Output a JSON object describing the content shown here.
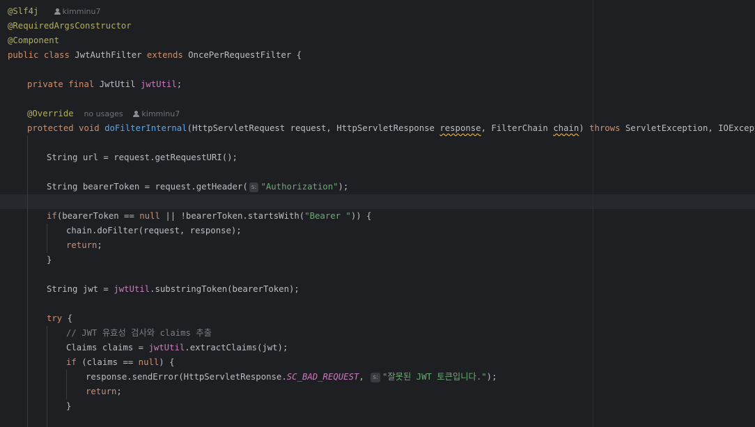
{
  "inlay": {
    "author": "kimminu7",
    "no_usages": "no usages",
    "param_s": "s:"
  },
  "code": {
    "l1_ann": "@Slf4j",
    "l2_ann": "@RequiredArgsConstructor",
    "l3_ann": "@Component",
    "l4_public": "public",
    "l4_class": "class",
    "l4_name": "JwtAuthFilter",
    "l4_extends": "extends",
    "l4_parent": "OncePerRequestFilter {",
    "l6_private": "private",
    "l6_final": "final",
    "l6_type": "JwtUtil",
    "l6_field": "jwtUtil",
    "l6_semi": ";",
    "l8_ann": "@Override",
    "l9_protected": "protected",
    "l9_void": "void",
    "l9_method": "doFilterInternal",
    "l9_params1": "(HttpServletRequest request, HttpServletResponse",
    "l9_response": "response",
    "l9_params2": ", FilterChain",
    "l9_chain": "chain",
    "l9_paren": ")",
    "l9_throws": "throws",
    "l9_exceptions": "ServletException, IOException {",
    "l11": "String url = request.getRequestURI();",
    "l13_a": "String bearerToken = request.getHeader(",
    "l13_str": "\"Authorization\"",
    "l13_b": ");",
    "l15_if": "if",
    "l15_a": "(bearerToken ==",
    "l15_null": "null",
    "l15_b": "|| !bearerToken.startsWith(",
    "l15_str": "\"Bearer \"",
    "l15_c": ")) {",
    "l16": "chain.doFilter(request, response);",
    "l17_return": "return",
    "l17_semi": ";",
    "l18": "}",
    "l20_a": "String jwt =",
    "l20_field": "jwtUtil",
    "l20_b": ".substringToken(bearerToken);",
    "l22_try": "try",
    "l22_brace": "{",
    "l23_comment": "// JWT 유효성 검사와 claims 추출",
    "l24_a": "Claims claims =",
    "l24_field": "jwtUtil",
    "l24_b": ".extractClaims(jwt);",
    "l25_if": "if",
    "l25_a": "(claims ==",
    "l25_null": "null",
    "l25_b": ") {",
    "l26_a": "response.sendError(HttpServletResponse.",
    "l26_const": "SC_BAD_REQUEST",
    "l26_b": ",",
    "l26_str": "\"잘못된 JWT 토큰입니다.\"",
    "l26_c": ");",
    "l27_return": "return",
    "l27_semi": ";",
    "l28": "}"
  }
}
